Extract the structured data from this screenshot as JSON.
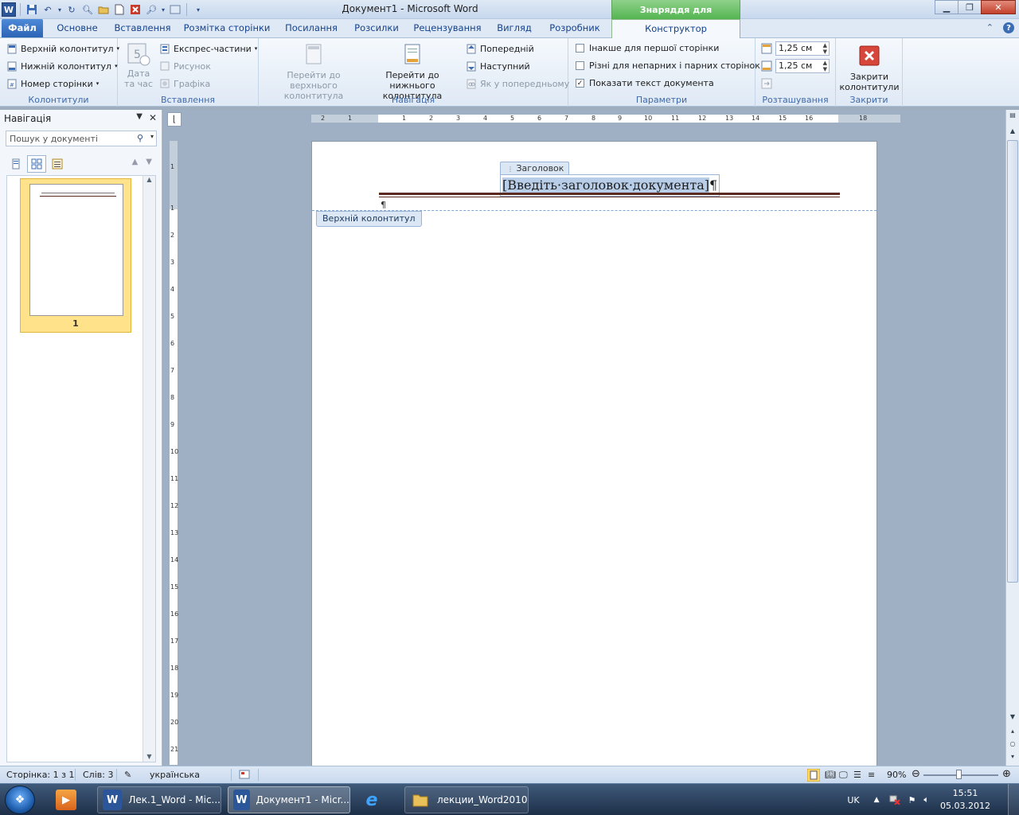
{
  "window": {
    "title": "Документ1  -  Microsoft Word",
    "context_header": "Знаряддя для колонтитулів"
  },
  "tabs": {
    "file": "Файл",
    "items": [
      "Основне",
      "Вставлення",
      "Розмітка сторінки",
      "Посилання",
      "Розсилки",
      "Рецензування",
      "Вигляд",
      "Розробник"
    ],
    "active": "Конструктор"
  },
  "ribbon": {
    "hf": {
      "title": "Колонтитули",
      "header": "Верхній колонтитул",
      "footer": "Нижній колонтитул",
      "pagenum": "Номер сторінки"
    },
    "insert": {
      "title": "Вставлення",
      "date_l1": "Дата",
      "date_l2": "та час",
      "express": "Експрес-частини",
      "picture": "Рисунок",
      "graphic": "Графіка"
    },
    "nav": {
      "title": "Навігація",
      "goto_header_l1": "Перейти до верхнього",
      "goto_header_l2": "колонтитула",
      "goto_footer_l1": "Перейти до нижнього",
      "goto_footer_l2": "колонтитула",
      "prev": "Попередній",
      "next": "Наступний",
      "link_prev": "Як у попередньому"
    },
    "options": {
      "title": "Параметри",
      "first_page": "Інакше для першої сторінки",
      "odd_even": "Різні для непарних і парних сторінок",
      "show_text": "Показати текст документа",
      "first_page_checked": false,
      "odd_even_checked": false,
      "show_text_checked": true
    },
    "position": {
      "title": "Розташування",
      "header_from_top": "1,25 см",
      "footer_from_bottom": "1,25 см"
    },
    "close": {
      "title": "Закрити",
      "btn_l1": "Закрити",
      "btn_l2": "колонтитули"
    }
  },
  "nav_pane": {
    "title": "Навігація",
    "search_placeholder": "Пошук у документі",
    "page_number": "1"
  },
  "ruler": {
    "h_labels": [
      "2",
      "1",
      "1",
      "2",
      "3",
      "4",
      "5",
      "6",
      "7",
      "8",
      "9",
      "10",
      "11",
      "12",
      "13",
      "14",
      "15",
      "16",
      "18"
    ],
    "v_labels": [
      "1",
      "1",
      "2",
      "3",
      "4",
      "5",
      "6",
      "7",
      "8",
      "9",
      "10",
      "11",
      "12",
      "13",
      "14",
      "15",
      "16",
      "17",
      "18",
      "19",
      "20",
      "21"
    ]
  },
  "document": {
    "header_tag": "Заголовок",
    "title_placeholder": "[Введіть·заголовок·документа]",
    "pilcrow": "¶",
    "header_label": "Верхній колонтитул"
  },
  "status": {
    "page": "Сторінка: 1 з 1",
    "words": "Слів: 3",
    "language": "українська",
    "zoom": "90%"
  },
  "taskbar": {
    "items": [
      "Лек.1_Word - Mic...",
      "Документ1 - Micr...",
      "лекции_Word2010"
    ],
    "lang": "UK",
    "time": "15:51",
    "date": "05.03.2012"
  }
}
